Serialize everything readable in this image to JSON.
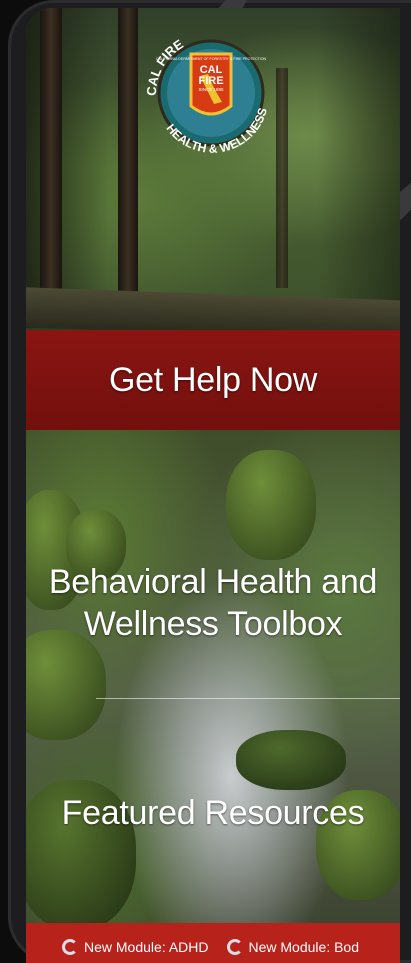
{
  "logo": {
    "arc_top": "CAL FIRE",
    "arc_bottom": "HEALTH & WELLNESS",
    "shield_small": "CALIFORNIA DEPARTMENT OF FORESTRY & FIRE PROTECTION",
    "shield_main_1": "CAL",
    "shield_main_2": "FIRE",
    "shield_since": "SINCE 1885"
  },
  "menu": {
    "get_help": "Get Help Now",
    "toolbox_line1": "Behavioral Health and",
    "toolbox_line2": "Wellness Toolbox",
    "featured": "Featured Resources"
  },
  "ticker": {
    "items": [
      {
        "label": "New Module: ADHD"
      },
      {
        "label": "New Module: Bod"
      }
    ]
  },
  "colors": {
    "banner_red": "#921210",
    "ticker_red": "#b7231b",
    "text": "#ffffff"
  }
}
